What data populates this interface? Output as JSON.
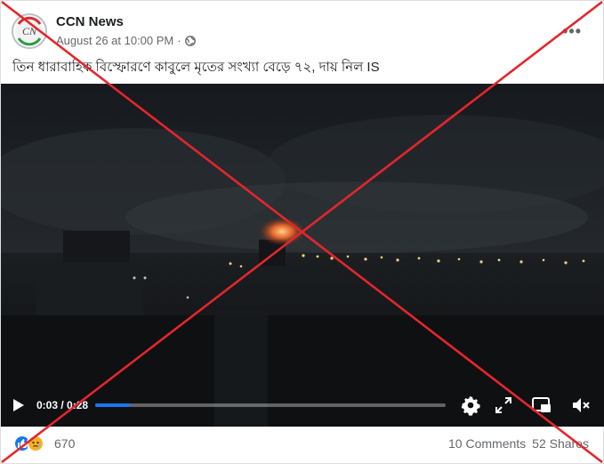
{
  "post": {
    "page_name": "CCN News",
    "timestamp": "August 26 at 10:00 PM",
    "separator": "·",
    "caption": "তিন ধারাবাহিক বিস্ফোরণে কাবুলে মৃতের সংখ্যা বেড়ে ৭২, দায় নিল IS",
    "avatar_text": "CN",
    "more_label": "•••"
  },
  "video": {
    "current_time": "0:03",
    "duration": "0:28",
    "time_separator": " / ",
    "progress_fraction": 0.1
  },
  "footer": {
    "reaction_count": "670",
    "comments": "10 Comments",
    "shares": "52 Shares"
  },
  "colors": {
    "accent": "#1877f2",
    "cross": "#e3262b"
  },
  "icons": [
    "globe-icon",
    "more-icon",
    "play-icon",
    "settings-icon",
    "fullscreen-icon",
    "pip-icon",
    "volume-icon",
    "like-icon",
    "sad-icon"
  ]
}
